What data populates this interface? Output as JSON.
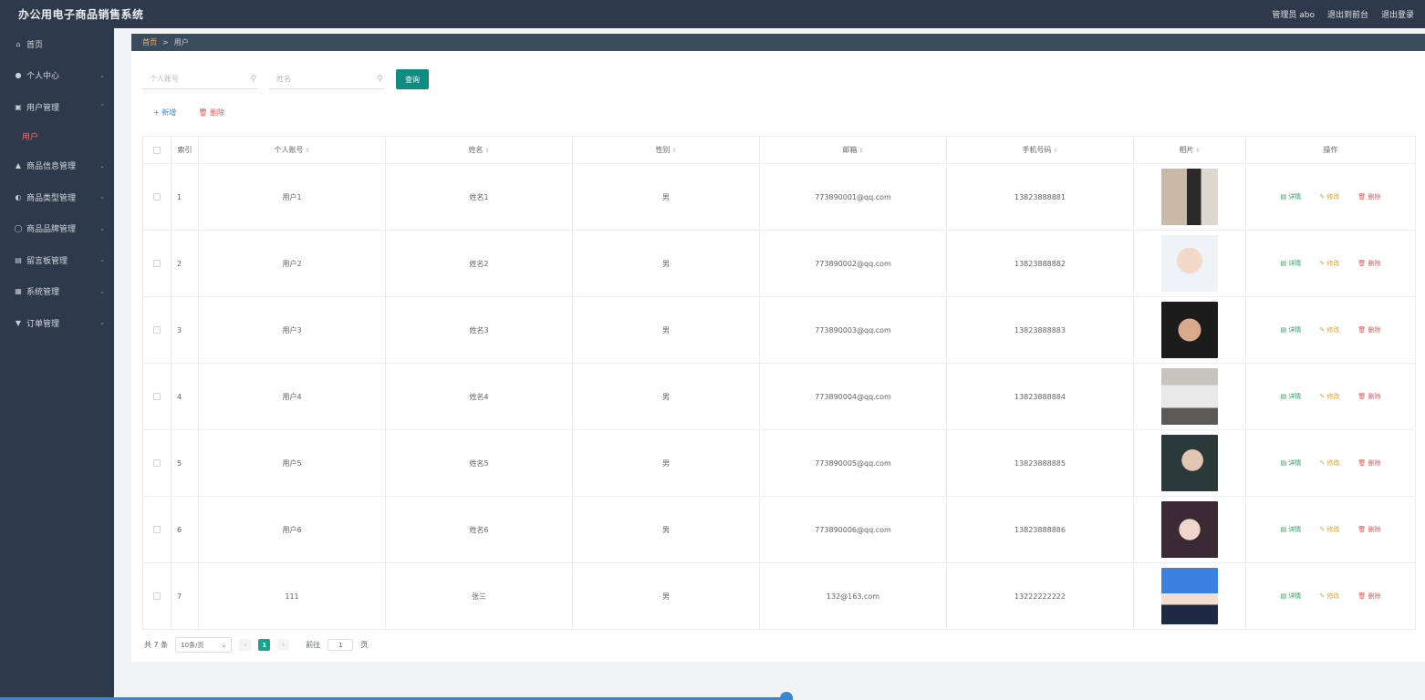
{
  "header": {
    "title": "办公用电子商品销售系统",
    "admin": "管理员 abo",
    "exit_front": "退出到前台",
    "logout": "退出登录"
  },
  "sidebar": {
    "items": [
      {
        "label": "首页",
        "icon": "home-icon",
        "glyph": "⌂",
        "arrow": ""
      },
      {
        "label": "个人中心",
        "icon": "user-icon",
        "glyph": "●",
        "arrow": "⌄"
      },
      {
        "label": "用户管理",
        "icon": "document-icon",
        "glyph": "▣",
        "arrow": "⌃"
      },
      {
        "label": "商品信息管理",
        "icon": "shop-icon",
        "glyph": "▲",
        "arrow": "⌄"
      },
      {
        "label": "商品类型管理",
        "icon": "bulb-icon",
        "glyph": "◐",
        "arrow": "⌄"
      },
      {
        "label": "商品品牌管理",
        "icon": "power-icon",
        "glyph": "◯",
        "arrow": "⌄"
      },
      {
        "label": "留言板管理",
        "icon": "board-icon",
        "glyph": "▤",
        "arrow": "⌄"
      },
      {
        "label": "系统管理",
        "icon": "grid-icon",
        "glyph": "▦",
        "arrow": "⌄"
      },
      {
        "label": "订单管理",
        "icon": "order-icon",
        "glyph": "▼",
        "arrow": "⌄"
      }
    ],
    "active_sub": "用户"
  },
  "breadcrumb": {
    "home": "首页",
    "sep": ">",
    "current": "用户"
  },
  "search": {
    "account_placeholder": "个人账号",
    "name_placeholder": "姓名",
    "query_label": "查询"
  },
  "actions": {
    "add": "+ 新增",
    "delete": "🗑 删除"
  },
  "table": {
    "headers": [
      "索引",
      "个人账号",
      "姓名",
      "性别",
      "邮箱",
      "手机号码",
      "相片",
      "操作"
    ],
    "rows": [
      {
        "index": "1",
        "account": "用户1",
        "name": "姓名1",
        "gender": "男",
        "email": "773890001@qq.com",
        "phone": "13823888881"
      },
      {
        "index": "2",
        "account": "用户2",
        "name": "姓名2",
        "gender": "男",
        "email": "773890002@qq.com",
        "phone": "13823888882"
      },
      {
        "index": "3",
        "account": "用户3",
        "name": "姓名3",
        "gender": "男",
        "email": "773890003@qq.com",
        "phone": "13823888883"
      },
      {
        "index": "4",
        "account": "用户4",
        "name": "姓名4",
        "gender": "男",
        "email": "773890004@qq.com",
        "phone": "13823888884"
      },
      {
        "index": "5",
        "account": "用户5",
        "name": "姓名5",
        "gender": "男",
        "email": "773890005@qq.com",
        "phone": "13823888885"
      },
      {
        "index": "6",
        "account": "用户6",
        "name": "姓名6",
        "gender": "男",
        "email": "773890006@qq.com",
        "phone": "13823888886"
      },
      {
        "index": "7",
        "account": "111",
        "name": "张三",
        "gender": "男",
        "email": "132@163.com",
        "phone": "13222222222"
      }
    ],
    "ops": {
      "detail": "详情",
      "edit": "修改",
      "delete": "删除"
    }
  },
  "pagination": {
    "total": "共 7 条",
    "page_size": "10条/页",
    "current_page": "1",
    "goto_prefix": "前往",
    "goto_value": "1",
    "goto_suffix": "页"
  },
  "colors": {
    "topbar": "#2e3a4a",
    "sidebar": "#2d3a4b",
    "accent": "#0f8b7f",
    "active_sub": "#f56c6c",
    "detail": "#2b9a5a",
    "edit": "#e3a32c",
    "delete": "#e05a5a"
  }
}
